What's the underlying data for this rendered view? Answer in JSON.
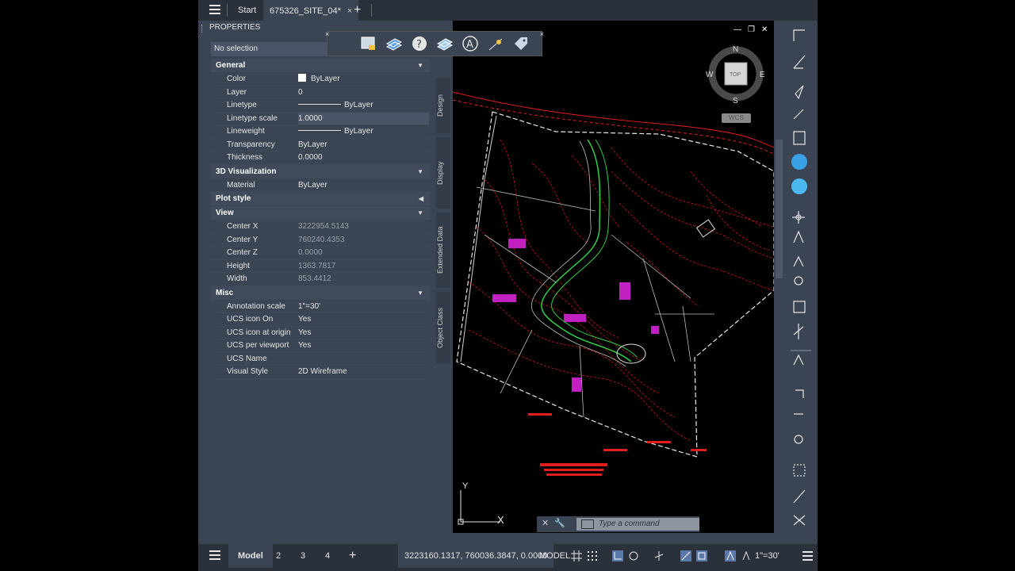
{
  "file_tabs": {
    "start": "Start",
    "document": "675326_SITE_04*",
    "close": "×",
    "add": "+"
  },
  "properties": {
    "title": "PROPERTIES",
    "selection": "No selection",
    "categories": {
      "general": "General",
      "visualization": "3D Visualization",
      "plot_style": "Plot style",
      "view": "View",
      "misc": "Misc"
    },
    "general": [
      {
        "k": "Color",
        "v": "ByLayer"
      },
      {
        "k": "Layer",
        "v": "0"
      },
      {
        "k": "Linetype",
        "v": "ByLayer"
      },
      {
        "k": "Linetype scale",
        "v": "1.0000"
      },
      {
        "k": "Lineweight",
        "v": "ByLayer"
      },
      {
        "k": "Transparency",
        "v": "ByLayer"
      },
      {
        "k": "Thickness",
        "v": "0.0000"
      }
    ],
    "visualization": [
      {
        "k": "Material",
        "v": "ByLayer"
      }
    ],
    "view": [
      {
        "k": "Center X",
        "v": "3222954.5143"
      },
      {
        "k": "Center Y",
        "v": "760240.4353"
      },
      {
        "k": "Center Z",
        "v": "0.0000"
      },
      {
        "k": "Height",
        "v": "1363.7817"
      },
      {
        "k": "Width",
        "v": "853.4412"
      }
    ],
    "misc": [
      {
        "k": "Annotation scale",
        "v": "1\"=30'"
      },
      {
        "k": "UCS icon On",
        "v": "Yes"
      },
      {
        "k": "UCS icon at origin",
        "v": "Yes"
      },
      {
        "k": "UCS per viewport",
        "v": "Yes"
      },
      {
        "k": "UCS Name",
        "v": ""
      },
      {
        "k": "Visual Style",
        "v": "2D Wireframe"
      }
    ],
    "side_tabs": [
      "Design",
      "Display",
      "Extended Data",
      "Object Class"
    ]
  },
  "viewcube": {
    "n": "N",
    "s": "S",
    "e": "E",
    "w": "W",
    "face": "TOP",
    "wcs": "WCS"
  },
  "ucs": {
    "x": "X",
    "y": "Y"
  },
  "command": {
    "placeholder": "Type a command"
  },
  "status": {
    "model_tab": "Model",
    "layouts": [
      "2",
      "3",
      "4"
    ],
    "add": "+",
    "coords": "3223160.1317, 760036.3847, 0.0000",
    "space": "MODEL",
    "scale": "1\"=30'"
  },
  "colors": {
    "accent": "#3b4453",
    "dark": "#2b313b",
    "contour_red": "#e01e1e",
    "magenta": "#c020c0",
    "green": "#2fd04a"
  }
}
